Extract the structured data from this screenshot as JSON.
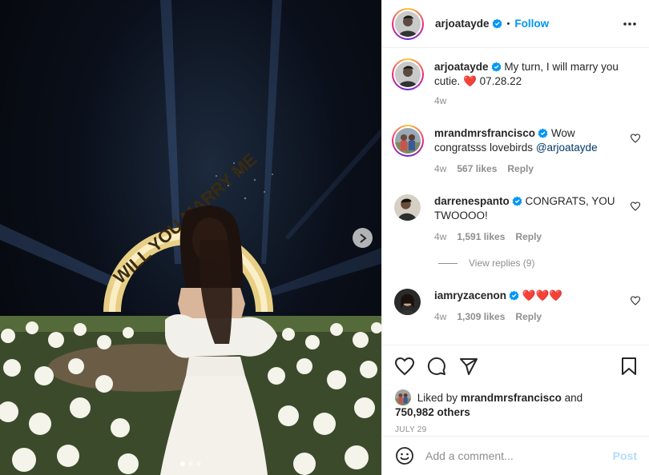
{
  "post": {
    "username": "arjoatayde",
    "follow_label": "Follow",
    "separator": "•",
    "slide_count": 3,
    "active_slide": 1,
    "media_sign_text": "WILL YOU MARRY ME"
  },
  "caption": {
    "username": "arjoatayde",
    "text": "My turn, I will marry you cutie.",
    "emoji": "❤️",
    "date_text": "07.28.22",
    "time": "4w"
  },
  "comments": [
    {
      "username": "mrandmrsfrancisco",
      "verified": true,
      "text_before": "Wow congratsss lovebirds",
      "mention": "@arjoatayde",
      "time": "4w",
      "likes": "567 likes",
      "reply": "Reply"
    },
    {
      "username": "darrenespanto",
      "verified": true,
      "text_before": "CONGRATS, YOU TWOOOO!",
      "mention": "",
      "time": "4w",
      "likes": "1,591 likes",
      "reply": "Reply",
      "view_replies": "View replies (9)"
    },
    {
      "username": "iamryzacenon",
      "verified": true,
      "text_before": "❤️❤️❤️",
      "mention": "",
      "time": "4w",
      "likes": "1,309 likes",
      "reply": "Reply"
    }
  ],
  "likes": {
    "prefix": "Liked by",
    "user": "mrandmrsfrancisco",
    "and": "and",
    "others": "750,982 others"
  },
  "date": "JULY 29",
  "add_comment": {
    "placeholder": "Add a comment...",
    "post_label": "Post"
  },
  "colors": {
    "link_blue": "#0095f6",
    "mention_blue": "#00376b",
    "heart_red": "#ed4956",
    "post_disabled": "#b3dbff"
  }
}
